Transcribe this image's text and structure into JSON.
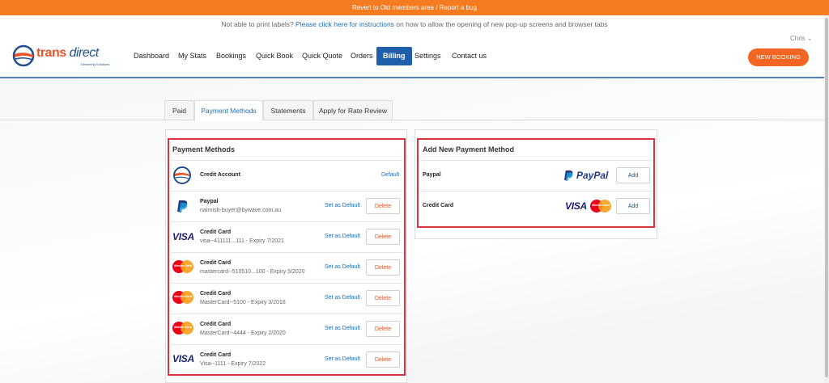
{
  "topbar": {
    "text": "Revert to Old members area / Report a bug"
  },
  "notice": {
    "before": "Not able to print labels? ",
    "link": "Please click here for instructions",
    "after": " on how to allow the opening of new pop-up screens and browser tabs"
  },
  "user": {
    "name": "Chris ⌄"
  },
  "logo": {
    "word_a": "trans",
    "word_b": "direct",
    "tagline": "Delivering Solutions"
  },
  "nav": {
    "dashboard": "Dashboard",
    "mystats": "My Stats",
    "bookings": "Bookings",
    "quickbook": "Quick Book",
    "quickquote": "Quick Quote",
    "orders": "Orders",
    "billing": "Billing",
    "settings": "Settings",
    "contact": "Contact us"
  },
  "new_booking": "NEW BOOKING",
  "tabs": {
    "paid": "Paid",
    "payment_methods": "Payment Methods",
    "statements": "Statements",
    "rate_review": "Apply for Rate Review"
  },
  "payment_methods": {
    "title": "Payment Methods",
    "credit_account": {
      "label": "Credit Account",
      "status": "Default"
    },
    "rows": [
      {
        "label": "Paypal",
        "sub": "nairnish-buyer@bywave.com.au",
        "action": "Set as Default",
        "delete": "Delete"
      },
      {
        "label": "Credit Card",
        "sub": "visa--411111...111 - Expiry 7/2021",
        "action": "Set as Default",
        "delete": "Delete"
      },
      {
        "label": "Credit Card",
        "sub": "mastercard--510510...100 - Expiry 5/2020",
        "action": "Set as Default",
        "delete": "Delete"
      },
      {
        "label": "Credit Card",
        "sub": "MasterCard--5100 - Expiry 3/2018",
        "action": "Set as Default",
        "delete": "Delete"
      },
      {
        "label": "Credit Card",
        "sub": "MasterCard--4444 - Expiry 2/2020",
        "action": "Set as Default",
        "delete": "Delete"
      },
      {
        "label": "Credit Card",
        "sub": "Visa--1111 - Expiry 7/2022",
        "action": "Set as Default",
        "delete": "Delete"
      }
    ]
  },
  "add_new": {
    "title": "Add New Payment Method",
    "paypal": {
      "label": "Paypal",
      "logo_text": "PayPal",
      "button": "Add"
    },
    "card": {
      "label": "Credit Card",
      "visa_text": "VISA",
      "mc_text": "MasterCard",
      "button": "Add"
    }
  },
  "colors": {
    "accent_orange": "#f47b20",
    "brand_blue": "#1f5ea8",
    "highlight_red": "#d9343a",
    "link_blue": "#1d70b8"
  }
}
